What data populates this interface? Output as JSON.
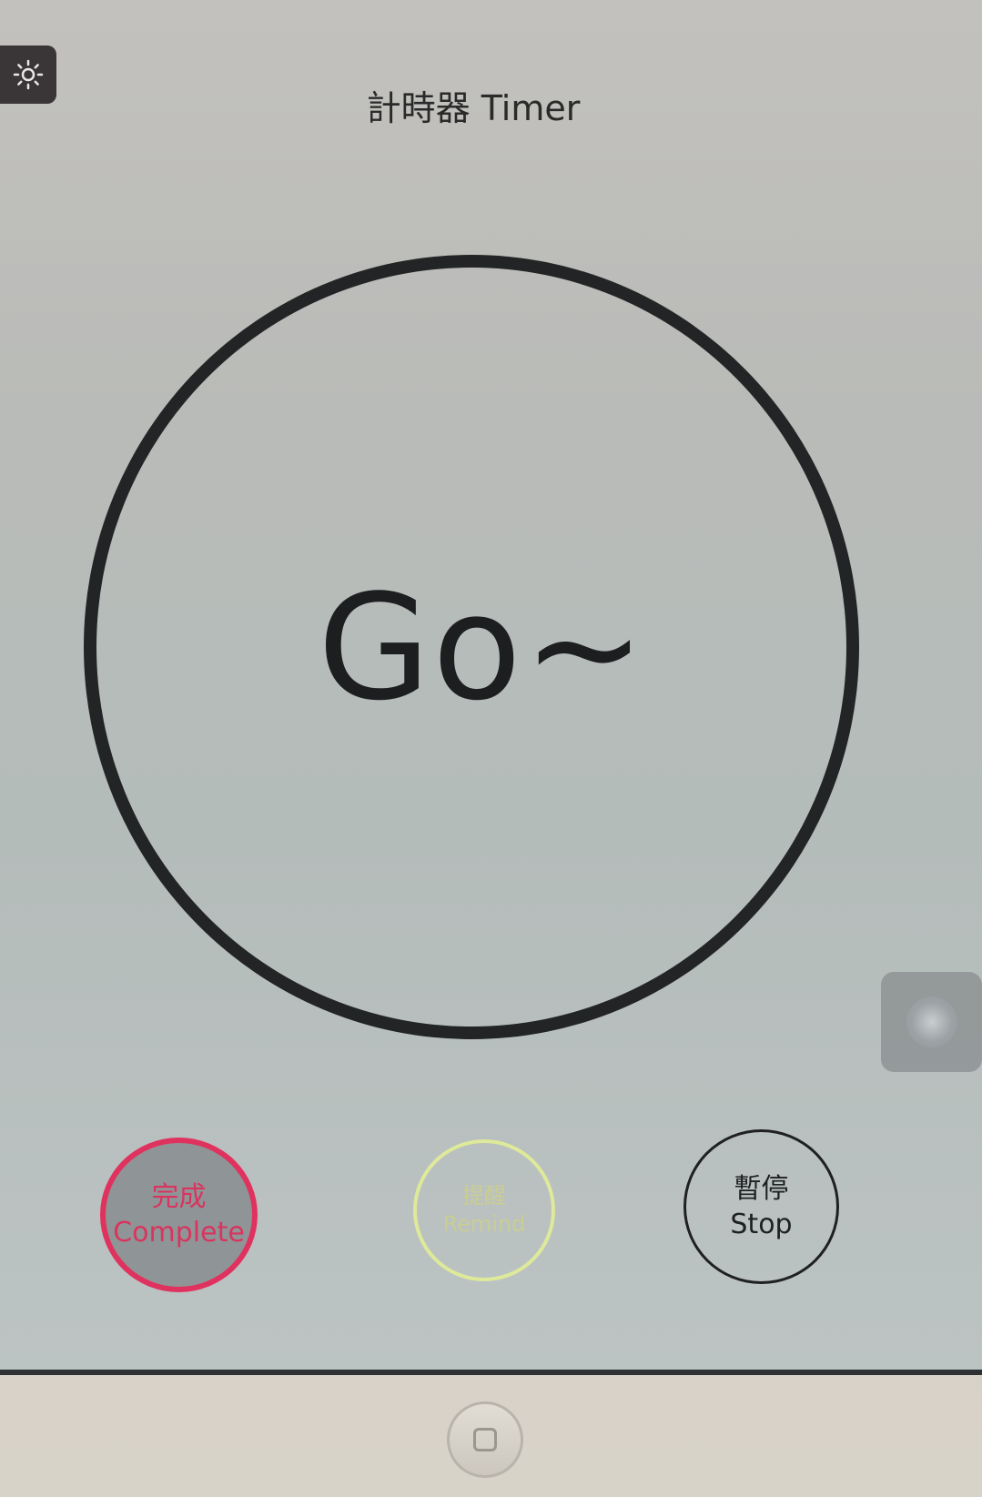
{
  "header": {
    "title": "計時器 Timer",
    "settings_icon": "sun-gear-icon"
  },
  "dial": {
    "display_text": "Go~"
  },
  "buttons": {
    "complete": {
      "zh": "完成",
      "en": "Complete",
      "color": "#e0325f"
    },
    "remind": {
      "zh": "提醒",
      "en": "Remind",
      "color": "#dfe99a"
    },
    "stop": {
      "zh": "暫停",
      "en": "Stop",
      "color": "#1f2022"
    }
  },
  "system": {
    "assistive_touch_icon": "assistive-touch-icon",
    "home_button_icon": "home-button-icon"
  }
}
